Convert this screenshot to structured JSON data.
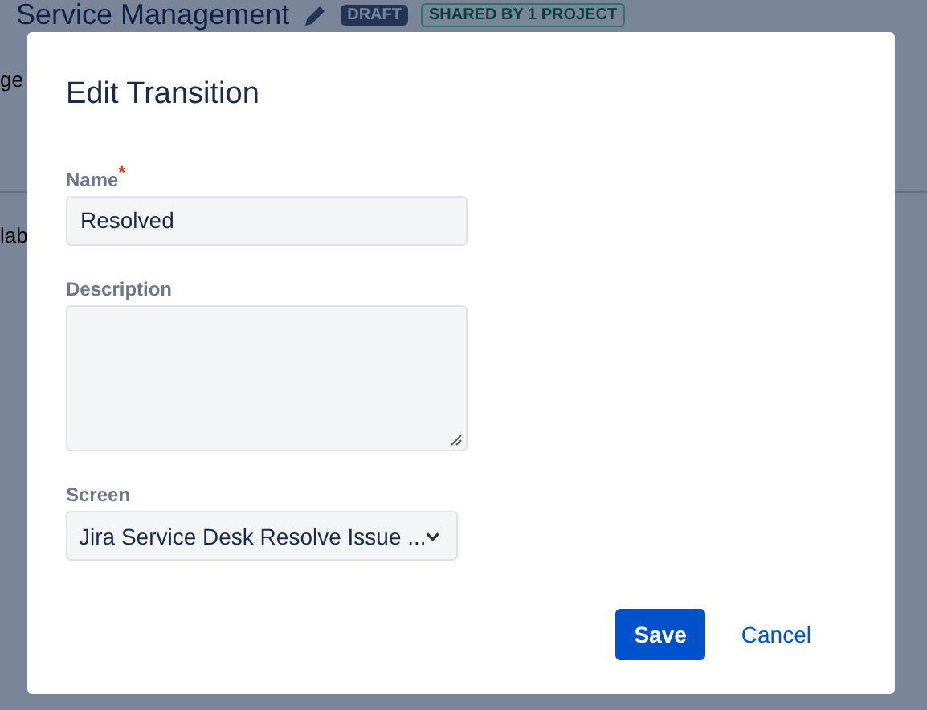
{
  "page": {
    "title": "Service Management",
    "badges": [
      {
        "label": "DRAFT",
        "kind": "dark"
      },
      {
        "label": "SHARED BY 1 PROJECT",
        "kind": "shared"
      }
    ],
    "line_1": "ge",
    "line_2": "lab"
  },
  "dialog": {
    "title": "Edit Transition",
    "name_field": {
      "label": "Name",
      "required": true,
      "required_mark": "*",
      "value": "Resolved"
    },
    "description_field": {
      "label": "Description"
    },
    "screen_field": {
      "label": "Screen",
      "value": "Jira Service Desk Resolve Issue ..."
    },
    "buttons": [
      {
        "label": "Save",
        "kind": "primary"
      },
      {
        "label": "Cancel",
        "kind": "link"
      }
    ]
  }
}
